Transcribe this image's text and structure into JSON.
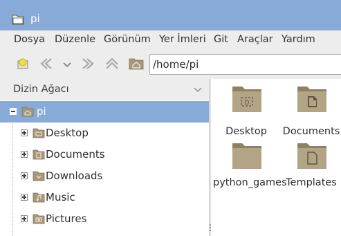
{
  "window": {
    "title": "pi"
  },
  "menu": [
    "Dosya",
    "Düzenle",
    "Görünüm",
    "Yer İmleri",
    "Git",
    "Araçlar",
    "Yardım"
  ],
  "toolbar": {
    "path_value": "/home/pi"
  },
  "sidebar": {
    "header": "Dizin Ağacı",
    "root": "pi",
    "items": [
      "Desktop",
      "Documents",
      "Downloads",
      "Music",
      "Pictures"
    ]
  },
  "files": [
    "Desktop",
    "Documents",
    "python_games",
    "Templates"
  ],
  "colors": {
    "accent": "#87aad8",
    "folder": "#a8987a"
  }
}
